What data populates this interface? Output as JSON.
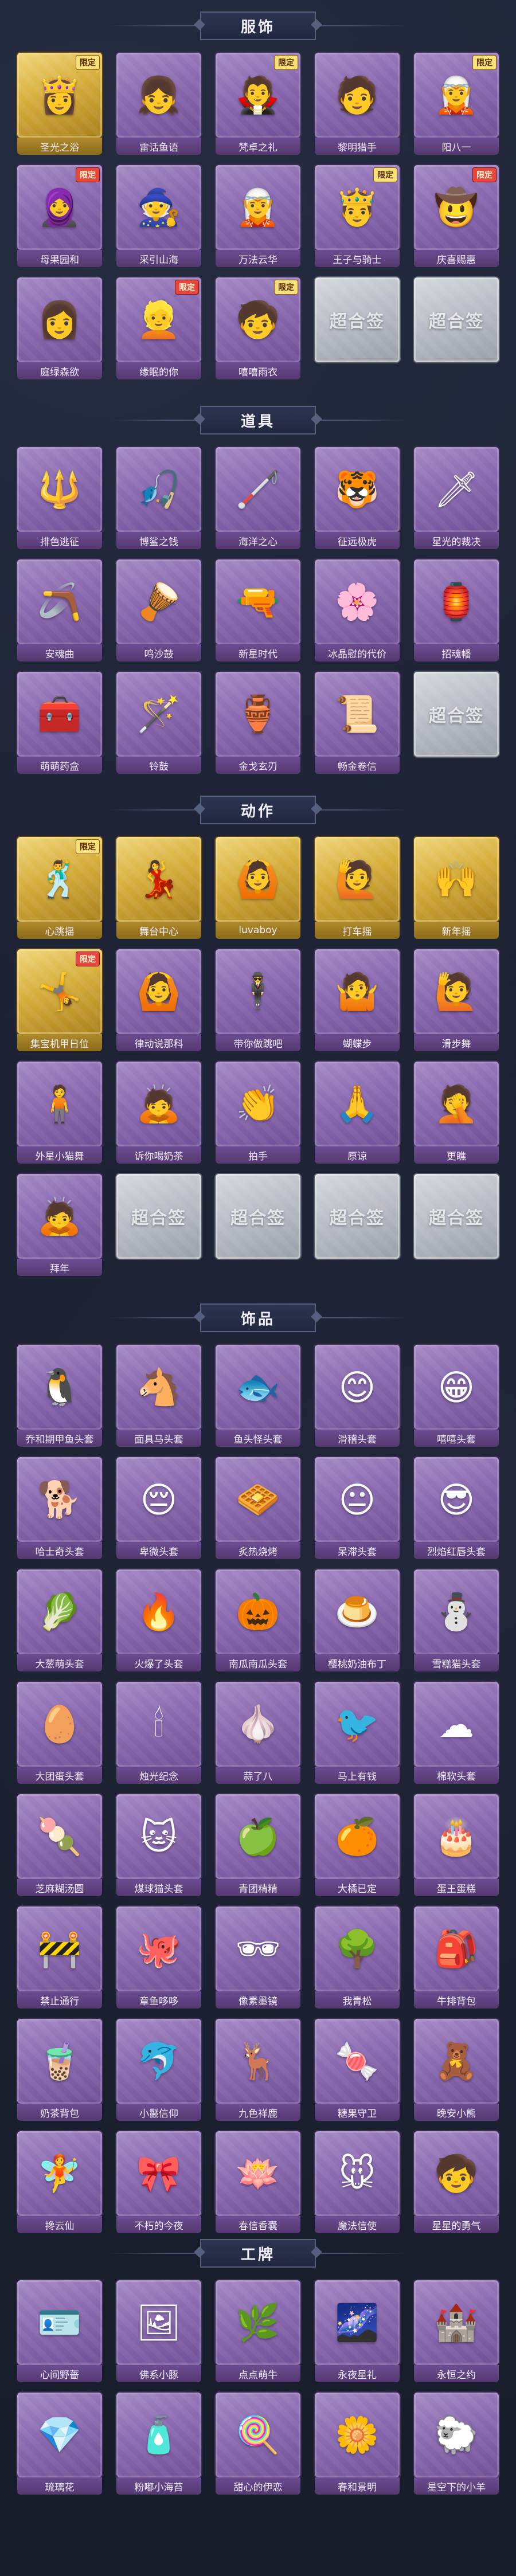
{
  "sections": [
    {
      "title": "服饰",
      "items": [
        {
          "label": "圣光之浴",
          "style": "gold",
          "icon": "👸",
          "badge": "限定"
        },
        {
          "label": "雷话鱼语",
          "style": "purple",
          "icon": "👧",
          "badge": ""
        },
        {
          "label": "梵卓之礼",
          "style": "purple",
          "icon": "🧛",
          "badge": "限定"
        },
        {
          "label": "黎明猎手",
          "style": "purple",
          "icon": "🧑",
          "badge": ""
        },
        {
          "label": "阳八一",
          "style": "purple",
          "icon": "🧝",
          "badge": "限定"
        },
        {
          "label": "母果园和",
          "style": "purple",
          "icon": "🧕",
          "badge": "限定"
        },
        {
          "label": "采引山海",
          "style": "purple",
          "icon": "🧙",
          "badge": ""
        },
        {
          "label": "万法云华",
          "style": "purple",
          "icon": "🧝",
          "badge": ""
        },
        {
          "label": "王子与骑士",
          "style": "purple",
          "icon": "🤴",
          "badge": "限定"
        },
        {
          "label": "庆喜赐惠",
          "style": "purple",
          "icon": "🤠",
          "badge": "限定"
        },
        {
          "label": "庭绿森欲",
          "style": "purple",
          "icon": "👩",
          "badge": ""
        },
        {
          "label": "缘眠的你",
          "style": "purple",
          "icon": "👱",
          "badge": "限定"
        },
        {
          "label": "嘻嘻雨衣",
          "style": "purple",
          "icon": "🧒",
          "badge": "限定"
        },
        {
          "label": "",
          "style": "silver",
          "icon": "超合签",
          "badge": ""
        },
        {
          "label": "",
          "style": "silver",
          "icon": "超合签",
          "badge": ""
        }
      ]
    },
    {
      "title": "道具",
      "items": [
        {
          "label": "排色逃征",
          "style": "purple",
          "icon": "🔱",
          "badge": ""
        },
        {
          "label": "博鲨之钱",
          "style": "purple",
          "icon": "🎣",
          "badge": ""
        },
        {
          "label": "海洋之心",
          "style": "purple",
          "icon": "🦯",
          "badge": ""
        },
        {
          "label": "征远极虎",
          "style": "purple",
          "icon": "🐯",
          "badge": ""
        },
        {
          "label": "星光的裁决",
          "style": "purple",
          "icon": "🗡",
          "badge": ""
        },
        {
          "label": "安魂曲",
          "style": "purple",
          "icon": "🪃",
          "badge": ""
        },
        {
          "label": "鸣沙鼓",
          "style": "purple",
          "icon": "🪘",
          "badge": ""
        },
        {
          "label": "新星时代",
          "style": "purple",
          "icon": "🔫",
          "badge": ""
        },
        {
          "label": "冰晶慰的代价",
          "style": "purple",
          "icon": "🌸",
          "badge": ""
        },
        {
          "label": "招魂幡",
          "style": "purple",
          "icon": "🏮",
          "badge": ""
        },
        {
          "label": "萌萌药盒",
          "style": "purple",
          "icon": "🧰",
          "badge": ""
        },
        {
          "label": "铃鼓",
          "style": "purple",
          "icon": "🪄",
          "badge": ""
        },
        {
          "label": "金戈玄刃",
          "style": "purple",
          "icon": "🏺",
          "badge": ""
        },
        {
          "label": "畅金卷信",
          "style": "purple",
          "icon": "📜",
          "badge": ""
        },
        {
          "label": "",
          "style": "silver",
          "icon": "超合签",
          "badge": ""
        }
      ]
    },
    {
      "title": "动作",
      "items": [
        {
          "label": "心跳摇",
          "style": "gold",
          "icon": "🕺",
          "badge": "限定"
        },
        {
          "label": "舞台中心",
          "style": "gold",
          "icon": "💃",
          "badge": ""
        },
        {
          "label": "luvaboy",
          "style": "gold",
          "icon": "🙆",
          "badge": ""
        },
        {
          "label": "打车摇",
          "style": "gold",
          "icon": "🙋",
          "badge": ""
        },
        {
          "label": "新年摇",
          "style": "gold",
          "icon": "🙌",
          "badge": ""
        },
        {
          "label": "集宝机甲日位",
          "style": "gold",
          "icon": "🤸",
          "badge": "限定"
        },
        {
          "label": "律动说那科",
          "style": "purple",
          "icon": "🙆",
          "badge": ""
        },
        {
          "label": "带你做跳吧",
          "style": "purple",
          "icon": "🕴",
          "badge": ""
        },
        {
          "label": "蝴蝶步",
          "style": "purple",
          "icon": "🤷",
          "badge": ""
        },
        {
          "label": "滑步舞",
          "style": "purple",
          "icon": "🙋",
          "badge": ""
        },
        {
          "label": "外星小猫舞",
          "style": "purple",
          "icon": "🧍",
          "badge": ""
        },
        {
          "label": "诉你喝奶茶",
          "style": "purple",
          "icon": "🙇",
          "badge": ""
        },
        {
          "label": "拍手",
          "style": "purple",
          "icon": "👏",
          "badge": ""
        },
        {
          "label": "原谅",
          "style": "purple",
          "icon": "🙏",
          "badge": ""
        },
        {
          "label": "更瞧",
          "style": "purple",
          "icon": "🤦",
          "badge": ""
        },
        {
          "label": "拜年",
          "style": "purple",
          "icon": "🙇",
          "badge": ""
        },
        {
          "label": "",
          "style": "silver",
          "icon": "超合签",
          "badge": ""
        },
        {
          "label": "",
          "style": "silver",
          "icon": "超合签",
          "badge": ""
        },
        {
          "label": "",
          "style": "silver",
          "icon": "超合签",
          "badge": ""
        },
        {
          "label": "",
          "style": "silver",
          "icon": "超合签",
          "badge": ""
        }
      ]
    },
    {
      "title": "饰品",
      "items": [
        {
          "label": "乔和期甲鱼头套",
          "style": "purple",
          "icon": "🐧",
          "badge": ""
        },
        {
          "label": "面具马头套",
          "style": "purple",
          "icon": "🐴",
          "badge": ""
        },
        {
          "label": "鱼头怪头套",
          "style": "purple",
          "icon": "🐟",
          "badge": ""
        },
        {
          "label": "滑稽头套",
          "style": "purple",
          "icon": "😊",
          "badge": ""
        },
        {
          "label": "嘻嘻头套",
          "style": "purple",
          "icon": "😁",
          "badge": ""
        },
        {
          "label": "哈士奇头套",
          "style": "purple",
          "icon": "🐕",
          "badge": ""
        },
        {
          "label": "卑微头套",
          "style": "purple",
          "icon": "😔",
          "badge": ""
        },
        {
          "label": "炙热烧烤",
          "style": "purple",
          "icon": "🧇",
          "badge": ""
        },
        {
          "label": "呆滞头套",
          "style": "purple",
          "icon": "😐",
          "badge": ""
        },
        {
          "label": "烈焰红唇头套",
          "style": "purple",
          "icon": "😎",
          "badge": ""
        },
        {
          "label": "大葱萌头套",
          "style": "purple",
          "icon": "🥬",
          "badge": ""
        },
        {
          "label": "火爆了头套",
          "style": "purple",
          "icon": "🔥",
          "badge": ""
        },
        {
          "label": "南瓜南瓜头套",
          "style": "purple",
          "icon": "🎃",
          "badge": ""
        },
        {
          "label": "樱桃奶油布丁",
          "style": "purple",
          "icon": "🍮",
          "badge": ""
        },
        {
          "label": "雪糕猫头套",
          "style": "purple",
          "icon": "⛄",
          "badge": ""
        },
        {
          "label": "大团蛋头套",
          "style": "purple",
          "icon": "🥚",
          "badge": ""
        },
        {
          "label": "烛光纪念",
          "style": "purple",
          "icon": "🕯",
          "badge": ""
        },
        {
          "label": "蒜了八",
          "style": "purple",
          "icon": "🧄",
          "badge": ""
        },
        {
          "label": "马上有钱",
          "style": "purple",
          "icon": "🐦",
          "badge": ""
        },
        {
          "label": "棉软头套",
          "style": "purple",
          "icon": "☁",
          "badge": ""
        },
        {
          "label": "芝麻糊汤圆",
          "style": "purple",
          "icon": "🍡",
          "badge": ""
        },
        {
          "label": "煤球猫头套",
          "style": "purple",
          "icon": "🐱",
          "badge": ""
        },
        {
          "label": "青团精精",
          "style": "purple",
          "icon": "🍏",
          "badge": ""
        },
        {
          "label": "大橘已定",
          "style": "purple",
          "icon": "🍊",
          "badge": ""
        },
        {
          "label": "蛋王蛋糕",
          "style": "purple",
          "icon": "🎂",
          "badge": ""
        },
        {
          "label": "禁止通行",
          "style": "purple",
          "icon": "🚧",
          "badge": ""
        },
        {
          "label": "章鱼哆哆",
          "style": "purple",
          "icon": "🐙",
          "badge": ""
        },
        {
          "label": "像素墨镜",
          "style": "purple",
          "icon": "🕶",
          "badge": ""
        },
        {
          "label": "我青松",
          "style": "purple",
          "icon": "🌳",
          "badge": ""
        },
        {
          "label": "牛排背包",
          "style": "purple",
          "icon": "🎒",
          "badge": ""
        },
        {
          "label": "奶茶背包",
          "style": "purple",
          "icon": "🧋",
          "badge": ""
        },
        {
          "label": "小鬣信仰",
          "style": "purple",
          "icon": "🐬",
          "badge": ""
        },
        {
          "label": "九色祥鹿",
          "style": "purple",
          "icon": "🦌",
          "badge": ""
        },
        {
          "label": "糖果守卫",
          "style": "purple",
          "icon": "🍬",
          "badge": ""
        },
        {
          "label": "晚安小熊",
          "style": "purple",
          "icon": "🧸",
          "badge": ""
        },
        {
          "label": "搀云仙",
          "style": "purple",
          "icon": "🧚",
          "badge": ""
        },
        {
          "label": "不朽的今夜",
          "style": "purple",
          "icon": "🎀",
          "badge": ""
        },
        {
          "label": "春信香囊",
          "style": "purple",
          "icon": "🪷",
          "badge": ""
        },
        {
          "label": "魔法信使",
          "style": "purple",
          "icon": "🐭",
          "badge": ""
        },
        {
          "label": "星星的勇气",
          "style": "purple",
          "icon": "🧒",
          "badge": ""
        }
      ]
    },
    {
      "title": "工牌",
      "items": [
        {
          "label": "心间野蔷",
          "style": "purple",
          "icon": "🪪",
          "badge": ""
        },
        {
          "label": "佛系小豚",
          "style": "purple",
          "icon": "🖼",
          "badge": ""
        },
        {
          "label": "点点萌牛",
          "style": "purple",
          "icon": "🌿",
          "badge": ""
        },
        {
          "label": "永夜星礼",
          "style": "purple",
          "icon": "🌌",
          "badge": ""
        },
        {
          "label": "永恒之约",
          "style": "purple",
          "icon": "🏰",
          "badge": ""
        },
        {
          "label": "琉璃花",
          "style": "purple",
          "icon": "💎",
          "badge": ""
        },
        {
          "label": "粉嘟小海苔",
          "style": "purple",
          "icon": "🧴",
          "badge": ""
        },
        {
          "label": "甜心的伊恋",
          "style": "purple",
          "icon": "🍭",
          "badge": ""
        },
        {
          "label": "春和景明",
          "style": "purple",
          "icon": "🌼",
          "badge": ""
        },
        {
          "label": "星空下的小羊",
          "style": "purple",
          "icon": "🐑",
          "badge": ""
        }
      ]
    }
  ]
}
